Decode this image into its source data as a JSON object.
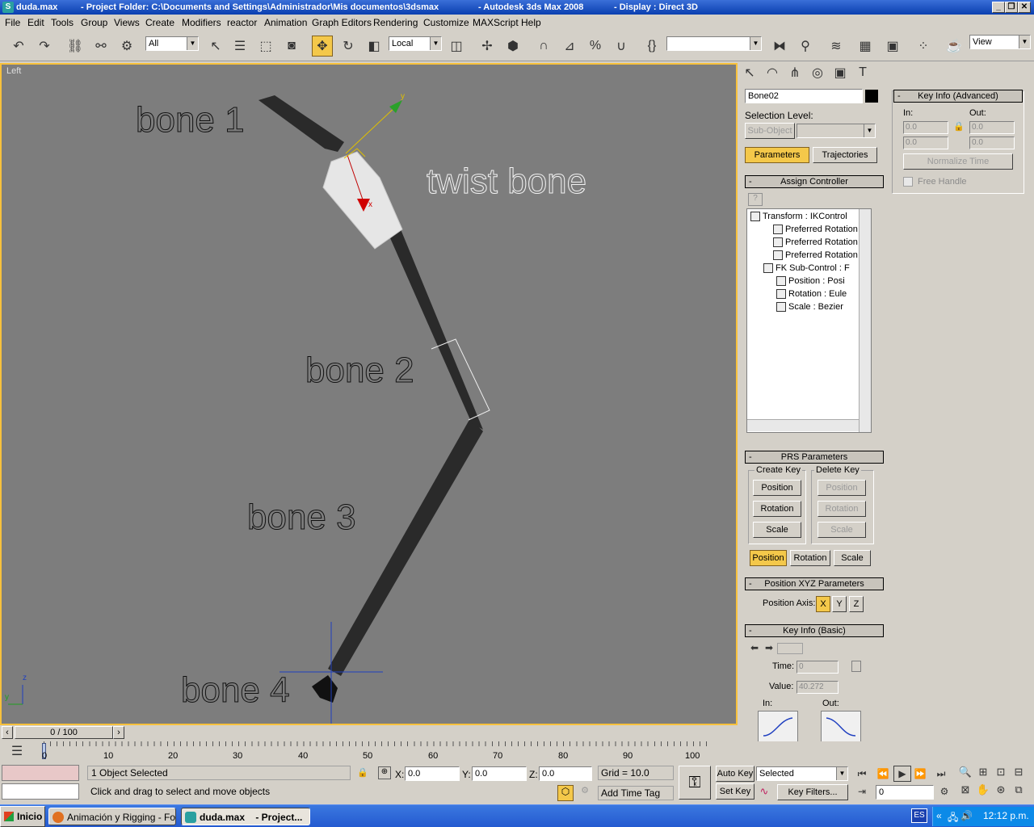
{
  "window": {
    "file": "duda.max",
    "project_folder": "- Project Folder: C:\\Documents and Settings\\Administrador\\Mis documentos\\3dsmax",
    "app": "- Autodesk 3ds Max 2008",
    "display": "- Display : Direct 3D"
  },
  "menu": [
    "File",
    "Edit",
    "Tools",
    "Group",
    "Views",
    "Create",
    "Modifiers",
    "reactor",
    "Animation",
    "Graph Editors",
    "Rendering",
    "Customize",
    "MAXScript",
    "Help"
  ],
  "toolbar": {
    "selection_filter": "All",
    "coord_system": "Local",
    "named_selection": "",
    "view_dropdown": "View"
  },
  "viewport": {
    "label": "Left",
    "bone_labels": [
      "bone 1",
      "bone 2",
      "bone 3",
      "bone 4"
    ],
    "twist_label": "twist bone",
    "gizmo_y": "y",
    "gizmo_x": "x",
    "axis_z": "z",
    "axis_y": "y"
  },
  "command_panel": {
    "object_name": "Bone02",
    "selection_level": "Selection Level:",
    "sub_object": "Sub-Object",
    "tabs": {
      "parameters": "Parameters",
      "trajectories": "Trajectories"
    },
    "assign_controller": "Assign Controller",
    "tree": [
      "Transform : IKControl",
      "Preferred Rotation",
      "Preferred Rotation",
      "Preferred Rotation",
      "FK Sub-Control : F",
      "Position : Posi",
      "Rotation : Eule",
      "Scale : Bezier"
    ],
    "prs_parameters": "PRS Parameters",
    "create_key": "Create Key",
    "delete_key": "Delete Key",
    "create_buttons": [
      "Position",
      "Rotation",
      "Scale"
    ],
    "delete_buttons": [
      "Position",
      "Rotation",
      "Scale"
    ],
    "prs_tabs": [
      "Position",
      "Rotation",
      "Scale"
    ],
    "position_xyz": "Position XYZ Parameters",
    "position_axis": "Position Axis:",
    "axes": [
      "X",
      "Y",
      "Z"
    ],
    "key_info_basic": "Key Info (Basic)",
    "time_label": "Time:",
    "time_value": "0",
    "value_label": "Value:",
    "value_value": "40.272",
    "in_label": "In:",
    "out_label": "Out:"
  },
  "key_info_advanced": {
    "title": "Key Info (Advanced)",
    "in_label": "In:",
    "out_label": "Out:",
    "in_values": [
      "0.0",
      "0.0"
    ],
    "out_values": [
      "0.0",
      "0.0"
    ],
    "normalize": "Normalize Time",
    "free_handle": "Free Handle"
  },
  "timeline": {
    "frame_display": "0 / 100",
    "ticks": [
      "0",
      "10",
      "20",
      "30",
      "40",
      "50",
      "60",
      "70",
      "80",
      "90",
      "100"
    ]
  },
  "status": {
    "objects_selected": "1 Object Selected",
    "prompt": "Click and drag to select and move objects",
    "x_label": "X:",
    "x_value": "0.0",
    "y_label": "Y:",
    "y_value": "0.0",
    "z_label": "Z:",
    "z_value": "0.0",
    "grid": "Grid = 10.0",
    "add_time_tag": "Add Time Tag",
    "auto_key": "Auto Key",
    "set_key": "Set Key",
    "selected": "Selected",
    "key_filters": "Key Filters...",
    "frame_field": "0"
  },
  "taskbar": {
    "start": "Inicio",
    "tasks": [
      "Animación y Rigging - Fo...",
      "duda.max    - Project..."
    ],
    "lang": "ES",
    "clock": "12:12 p.m."
  },
  "colors": {
    "accent": "#f4c84a",
    "viewport_bg": "#7d7d7d",
    "viewport_border": "#f7c13c",
    "bone": "#2a2a2a",
    "twist_bone": "#e6e6e6"
  }
}
